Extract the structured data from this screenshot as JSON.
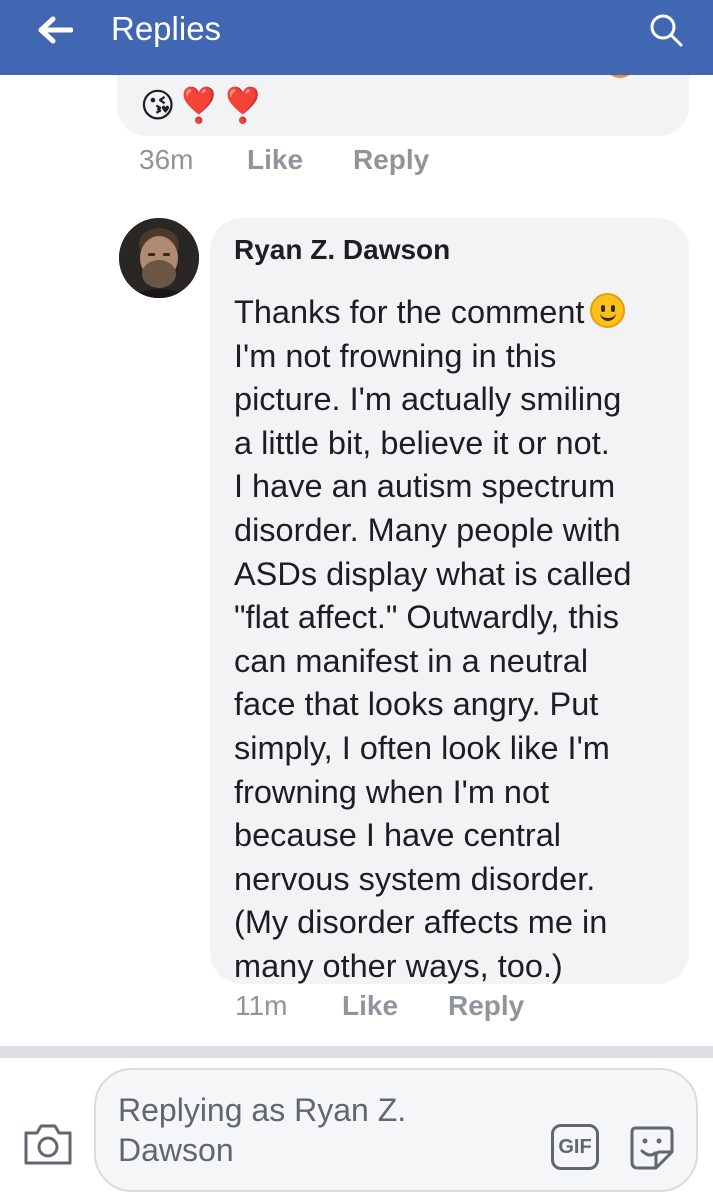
{
  "header": {
    "title": "Replies",
    "back_icon": "arrow-left-icon",
    "search_icon": "search-icon",
    "background": "#4267b2"
  },
  "previous_reply": {
    "emojis": "😘❣️❣️",
    "time": "36m",
    "like_label": "Like",
    "reply_label": "Reply"
  },
  "comment": {
    "author": "Ryan Z. Dawson",
    "first_line": "Thanks for the comment",
    "emoji_icon": "slightly-smiling-face-icon",
    "text": "I'm not frowning in this\npicture.  I'm actually smiling\na little bit, believe it or not.\nI have an autism spectrum\ndisorder.  Many people with\nASDs display what is called\n\"flat affect.\"  Outwardly, this\ncan manifest in a neutral\nface that looks angry.  Put\nsimply, I often look like I'm\nfrowning when I'm not\nbecause I have central\nnervous system disorder.\n(My disorder affects me in\nmany other ways, too.)",
    "time": "11m",
    "like_label": "Like",
    "reply_label": "Reply"
  },
  "composer": {
    "placeholder": "Replying as Ryan Z. Dawson",
    "camera_icon": "camera-icon",
    "gif_label": "GIF",
    "sticker_icon": "sticker-icon"
  },
  "colors": {
    "accent": "#4267b2",
    "bubble": "#f2f3f5",
    "meta_text": "#90949c"
  }
}
